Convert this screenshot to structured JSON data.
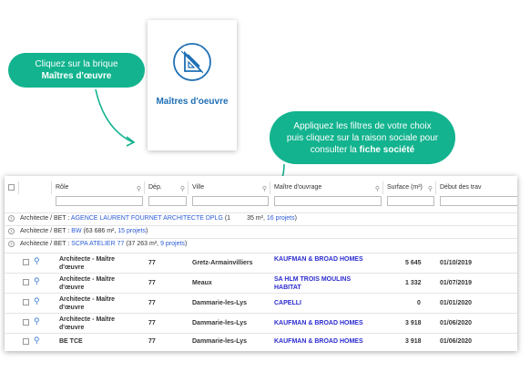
{
  "tile": {
    "label": "Maîtres d'oeuvre",
    "icon": "ruler-square-icon"
  },
  "bubble1": {
    "line1": "Cliquez sur la brique",
    "line2": "Maîtres d'œuvre"
  },
  "bubble2": {
    "line1": "Appliquez les filtres de votre choix",
    "line2": "puis cliquez sur la raison sociale pour",
    "line3_prefix": "consulter la ",
    "line3_bold": "fiche société"
  },
  "accent": "#12b38e",
  "grid": {
    "headers": {
      "role": "Rôle",
      "dep": "Dép.",
      "ville": "Ville",
      "mo": "Maître d'ouvrage",
      "surface": "Surface (m²)",
      "debut": "Début des trav"
    },
    "groups": [
      {
        "prefix": "Architecte / BET : ",
        "name": "AGENCE LAURENT FOURNET ARCHITECTE DPLG",
        "stats1": " (1",
        "stats2": "35 m², ",
        "projets": "16 projets",
        "close": ")"
      },
      {
        "prefix": "Architecte / BET : ",
        "name": "BW",
        "stats1": " (63 686 m², ",
        "stats2": "",
        "projets": "15 projets",
        "close": ")"
      },
      {
        "prefix": "Architecte / BET : ",
        "name": "SCPA ATELIER 77",
        "stats1": " (37 263 m², ",
        "stats2": "",
        "projets": "9 projets",
        "close": ")"
      }
    ],
    "rows": [
      {
        "role1": "Architecte - Maître",
        "role2": "d'œuvre",
        "dep": "77",
        "ville": "Gretz-Armainvilliers",
        "mo1": "KAUFMAN & BROAD HOMES",
        "mo2": "",
        "surface": "5 645",
        "debut": "01/10/2019"
      },
      {
        "role1": "Architecte - Maître",
        "role2": "d'œuvre",
        "dep": "77",
        "ville": "Meaux",
        "mo1": "SA HLM TROIS MOULINS",
        "mo2": "HABITAT",
        "surface": "1 332",
        "debut": "01/07/2019"
      },
      {
        "role1": "Architecte - Maître",
        "role2": "d'œuvre",
        "dep": "77",
        "ville": "Dammarie-les-Lys",
        "mo1": "CAPELLI",
        "mo2": "",
        "surface": "0",
        "debut": "01/01/2020"
      },
      {
        "role1": "Architecte - Maître",
        "role2": "d'œuvre",
        "dep": "77",
        "ville": "Dammarie-les-Lys",
        "mo1": "KAUFMAN & BROAD HOMES",
        "mo2": "",
        "surface": "3 918",
        "debut": "01/06/2020"
      },
      {
        "role1": "BE TCE",
        "role2": "",
        "dep": "77",
        "ville": "Dammarie-les-Lys",
        "mo1": "KAUFMAN & BROAD HOMES",
        "mo2": "",
        "surface": "3 918",
        "debut": "01/06/2020"
      }
    ]
  }
}
